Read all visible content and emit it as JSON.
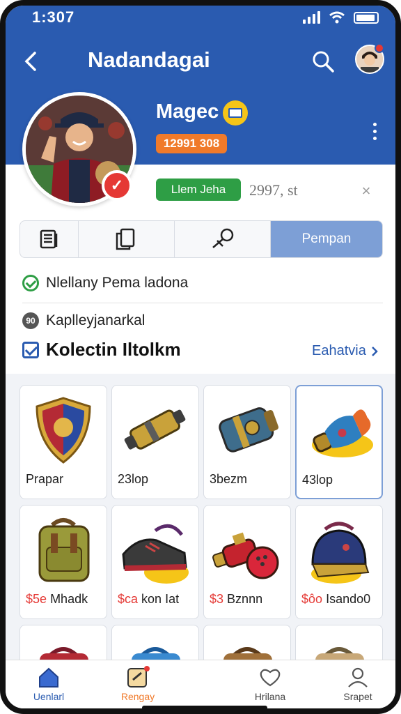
{
  "status_bar": {
    "time": "1:307"
  },
  "nav": {
    "title": "Nadandagai"
  },
  "profile": {
    "name": "Magec",
    "id_badge": "12991 308",
    "status_label": "Llem Jeha",
    "followers_text": "2997, st"
  },
  "tabs": [
    {
      "icon": "document-icon"
    },
    {
      "icon": "copy-icon"
    },
    {
      "icon": "pin-icon"
    },
    {
      "label": "Pempan"
    }
  ],
  "info": {
    "line1": "Nlellany Pema ladona",
    "line2": "Kaplleyjanarkal"
  },
  "section": {
    "title": "Kolectin Iltolkm",
    "see_all": "Eahatvia"
  },
  "items": [
    {
      "label": "Prapar",
      "art": "shield-crest-icon"
    },
    {
      "label": "23lop",
      "art": "scroll-tube-icon"
    },
    {
      "label": "3bezm",
      "art": "lantern-drum-icon"
    },
    {
      "label": "43lop",
      "art": "feather-horn-icon"
    },
    {
      "price": "$5e",
      "name": "Mhadk",
      "art": "backpack-icon"
    },
    {
      "price": "$ca",
      "name": "kon Iat",
      "art": "sneaker-icon"
    },
    {
      "price": "$3",
      "name": "Bznnn",
      "art": "bowling-cannon-icon"
    },
    {
      "price": "$ôo",
      "name": "Isando0",
      "art": "helmet-icon"
    },
    {
      "art": "bag-icon"
    },
    {
      "art": "bag-icon"
    },
    {
      "art": "bag-icon"
    },
    {
      "art": "bag-icon"
    }
  ],
  "bottom_nav": [
    {
      "label": "Uenlarl",
      "icon": "home-icon"
    },
    {
      "label": "Rengay",
      "icon": "pencil-note-icon"
    },
    {
      "label": "Hrilana",
      "icon": "heart-icon"
    },
    {
      "label": "Srapet",
      "icon": "person-icon"
    }
  ],
  "colors": {
    "header": "#2a5bb0",
    "accent_orange": "#f07a2a",
    "status_green": "#2e9e45",
    "badge_red": "#e53935",
    "tab_active": "#7d9fd6"
  }
}
